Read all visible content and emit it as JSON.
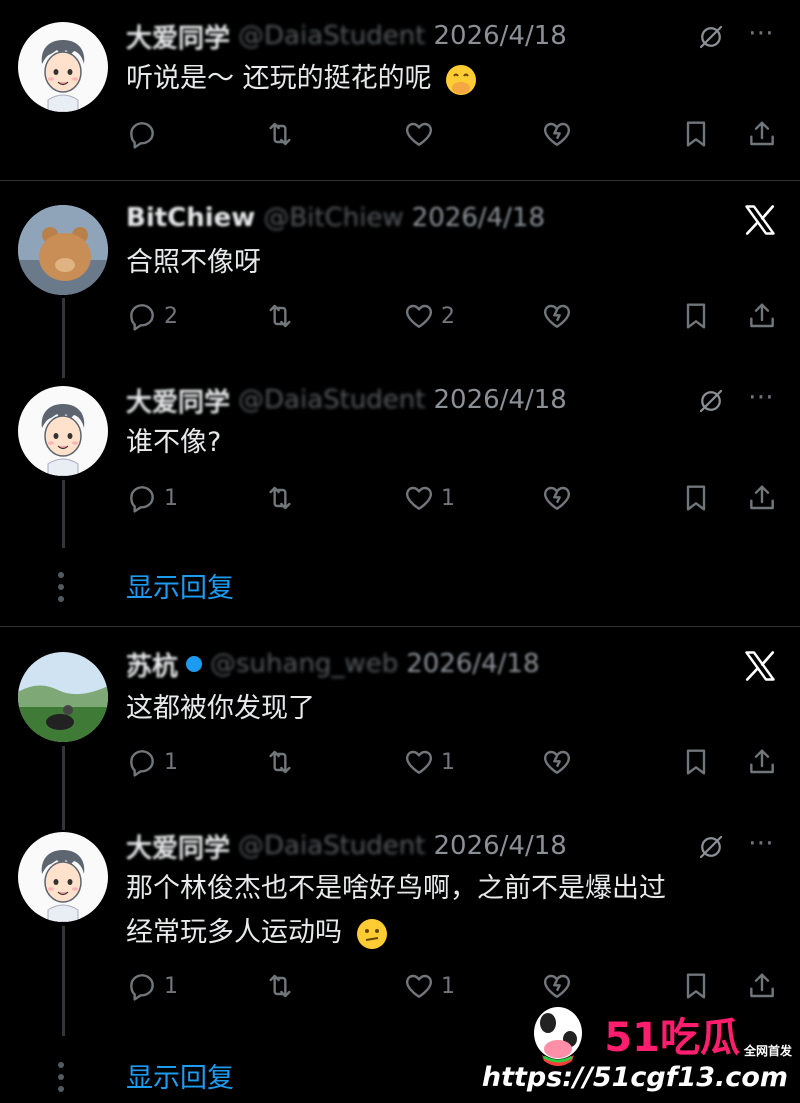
{
  "tweets": [
    {
      "name": "大爱同学",
      "handle": "@DaiaStudent",
      "date": "2026/4/18",
      "text": "听说是～ 还玩的挺花的呢",
      "replies": "",
      "likes": ""
    },
    {
      "name": "BitChiew",
      "handle": "@BitChiew",
      "date": "2026/4/18",
      "text": "合照不像呀",
      "replies": "2",
      "likes": "2"
    },
    {
      "name": "大爱同学",
      "handle": "@DaiaStudent",
      "date": "2026/4/18",
      "text": "谁不像?",
      "replies": "1",
      "likes": "1"
    },
    {
      "name": "苏杭",
      "handle": "@suhang_web",
      "date": "2026/4/18",
      "text": "这都被你发现了",
      "replies": "1",
      "likes": "1"
    },
    {
      "name": "大爱同学",
      "handle": "@DaiaStudent",
      "date": "2026/4/18",
      "text_line1": "那个林俊杰也不是啥好鸟啊，之前不是爆出过",
      "text_line2": "经常玩多人运动吗",
      "replies": "1",
      "likes": "1"
    }
  ],
  "show_replies_label": "显示回复",
  "watermark": {
    "brand": "51吃瓜",
    "tag": "全网首发",
    "url": "https://51cgf13.com"
  },
  "icons": [
    "reply-icon",
    "retweet-icon",
    "like-icon",
    "dislike-icon",
    "bookmark-icon",
    "share-icon",
    "grok-slash-icon",
    "more-icon",
    "x-logo-icon"
  ],
  "colors": {
    "background": "#000000",
    "text": "#e7e9ea",
    "muted": "#71767b",
    "link": "#1d9bf0",
    "brand": "#ff1e6e"
  }
}
